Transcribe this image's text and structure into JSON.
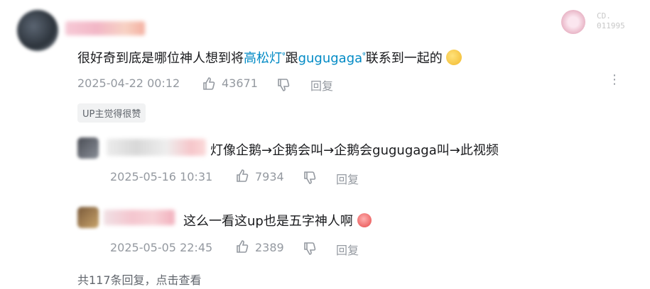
{
  "comment": {
    "text_before": "很好奇到底是哪位神人想到将",
    "link1": "高松灯",
    "text_mid": "跟",
    "link2": "gugugaga",
    "text_after": "联系到一起的",
    "emoji": "thinking-face",
    "date": "2025-04-22 00:12",
    "likes": "43671",
    "reply_label": "回复",
    "badge": "UP主觉得很赞",
    "badge_text": "CD.\n011995"
  },
  "replies": [
    {
      "text": "灯像企鹅→企鹅会叫→企鹅会gugugaga叫→此视频",
      "date": "2025-05-16 10:31",
      "likes": "7934",
      "reply_label": "回复"
    },
    {
      "text": "这么一看这up也是五字神人啊",
      "emoji": "angry-face",
      "date": "2025-05-05 22:45",
      "likes": "2389",
      "reply_label": "回复"
    }
  ],
  "more_replies": "共117条回复，点击查看"
}
